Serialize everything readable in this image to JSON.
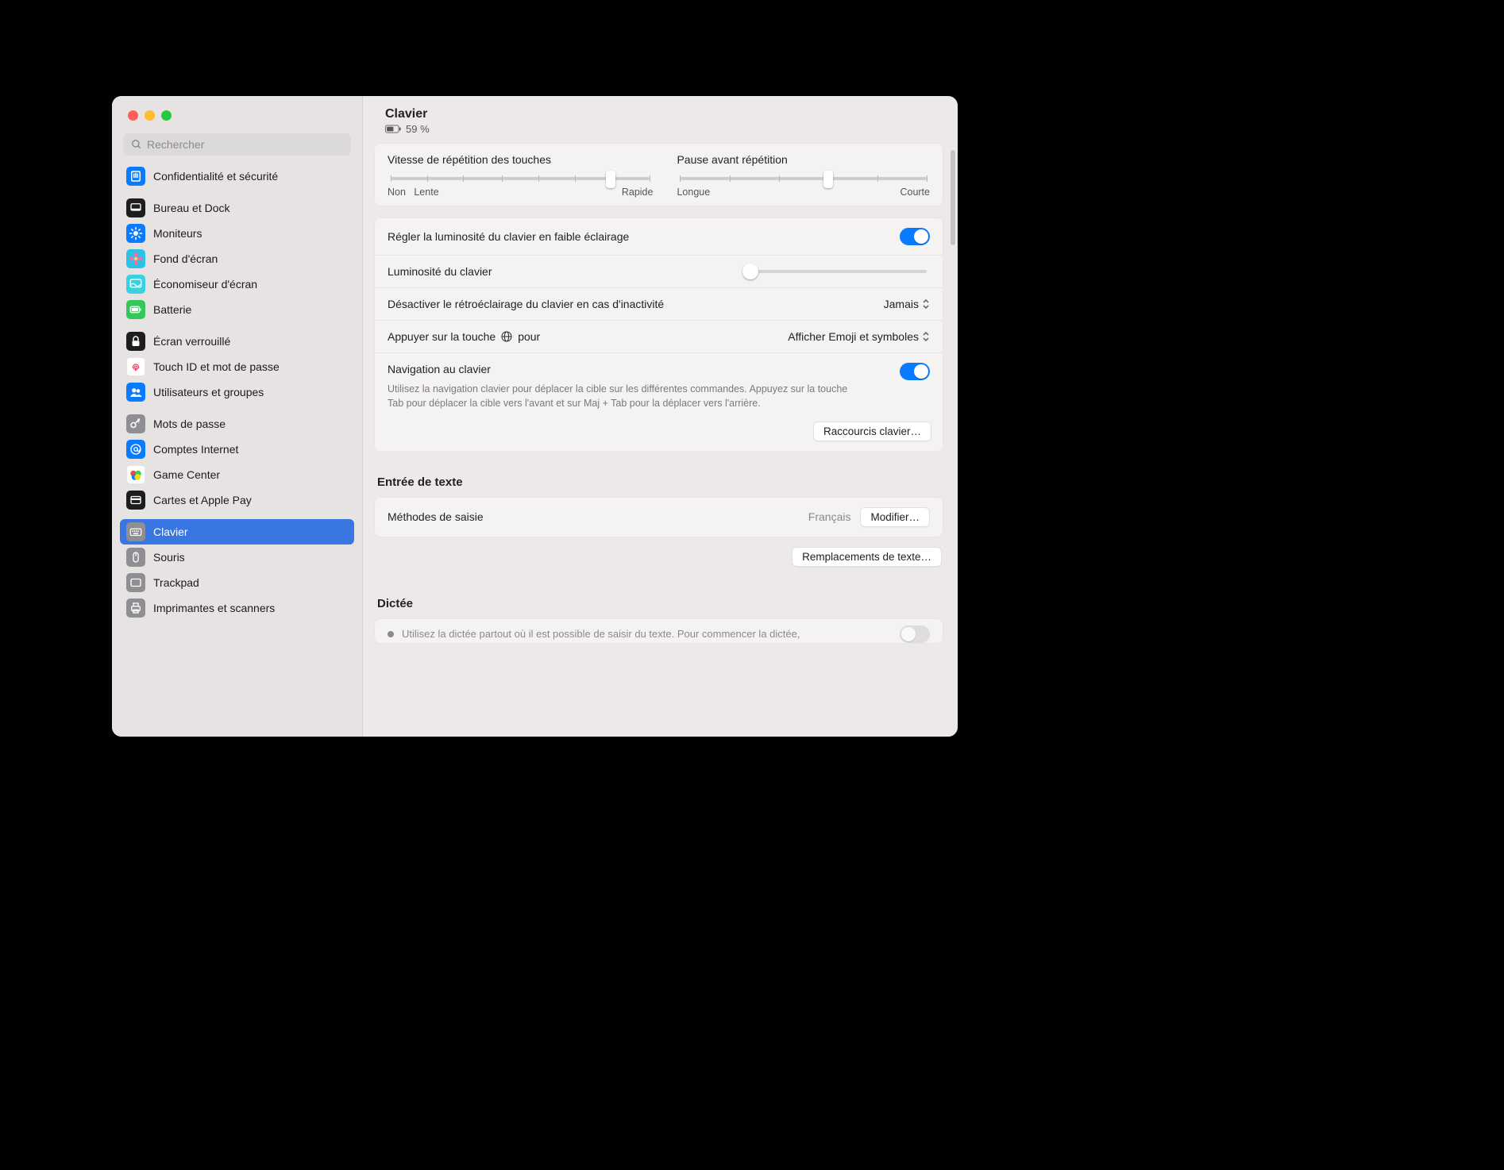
{
  "header": {
    "title": "Clavier",
    "battery_pct": "59 %"
  },
  "search": {
    "placeholder": "Rechercher"
  },
  "sidebar": [
    {
      "key": "privacy",
      "label": "Confidentialité et sécurité",
      "bg": "#0a7bff",
      "icon": "hand"
    },
    {
      "key": "desktop",
      "label": "Bureau et Dock",
      "bg": "#1d1d1d",
      "icon": "dock"
    },
    {
      "key": "displays",
      "label": "Moniteurs",
      "bg": "#0a7bff",
      "icon": "sun"
    },
    {
      "key": "wallpaper",
      "label": "Fond d'écran",
      "bg": "#29c3e6",
      "icon": "flower"
    },
    {
      "key": "screensaver",
      "label": "Économiseur d'écran",
      "bg": "#37d1e0",
      "icon": "screensaver"
    },
    {
      "key": "battery",
      "label": "Batterie",
      "bg": "#34c759",
      "icon": "battery"
    },
    {
      "key": "lockscreen",
      "label": "Écran verrouillé",
      "bg": "#1d1d1d",
      "icon": "lock"
    },
    {
      "key": "touchid",
      "label": "Touch ID et mot de passe",
      "bg": "#ffffff",
      "icon": "fingerprint"
    },
    {
      "key": "users",
      "label": "Utilisateurs et groupes",
      "bg": "#0a7bff",
      "icon": "users"
    },
    {
      "key": "passwords",
      "label": "Mots de passe",
      "bg": "#8e8e93",
      "icon": "key"
    },
    {
      "key": "internet",
      "label": "Comptes Internet",
      "bg": "#0a7bff",
      "icon": "at"
    },
    {
      "key": "gamecenter",
      "label": "Game Center",
      "bg": "#ffffff",
      "icon": "gamecenter"
    },
    {
      "key": "wallet",
      "label": "Cartes et Apple Pay",
      "bg": "#1d1d1d",
      "icon": "wallet"
    },
    {
      "key": "keyboard",
      "label": "Clavier",
      "bg": "#8e8e93",
      "icon": "keyboard",
      "selected": true
    },
    {
      "key": "mouse",
      "label": "Souris",
      "bg": "#8e8e93",
      "icon": "mouse"
    },
    {
      "key": "trackpad",
      "label": "Trackpad",
      "bg": "#8e8e93",
      "icon": "trackpad"
    },
    {
      "key": "printers",
      "label": "Imprimantes et scanners",
      "bg": "#8e8e93",
      "icon": "printer"
    }
  ],
  "sliders": {
    "repeat": {
      "label": "Vitesse de répétition des touches",
      "min": "Non",
      "mid": "Lente",
      "max": "Rapide"
    },
    "delay": {
      "label": "Pause avant répétition",
      "min": "Longue",
      "max": "Courte"
    }
  },
  "rows": {
    "autobright": "Régler la luminosité du clavier en faible éclairage",
    "brightness": "Luminosité du clavier",
    "backlight_off": "Désactiver le rétroéclairage du clavier en cas d'inactivité",
    "backlight_off_value": "Jamais",
    "globe": "Appuyer sur la touche",
    "globe_suffix": "pour",
    "globe_value": "Afficher Emoji et symboles",
    "kbnav": "Navigation au clavier",
    "kbnav_desc": "Utilisez la navigation clavier pour déplacer la cible sur les différentes commandes. Appuyez sur la touche Tab pour déplacer la cible vers l'avant et sur Maj + Tab pour la déplacer vers l'arrière.",
    "shortcuts_btn": "Raccourcis clavier…"
  },
  "text": {
    "section": "Entrée de texte",
    "input_methods": "Méthodes de saisie",
    "input_value": "Français",
    "modify_btn": "Modifier…",
    "replace_btn": "Remplacements de texte…"
  },
  "dictation": {
    "section": "Dictée",
    "cut": "Utilisez la dictée partout où il est possible de saisir du texte. Pour commencer la dictée,"
  }
}
